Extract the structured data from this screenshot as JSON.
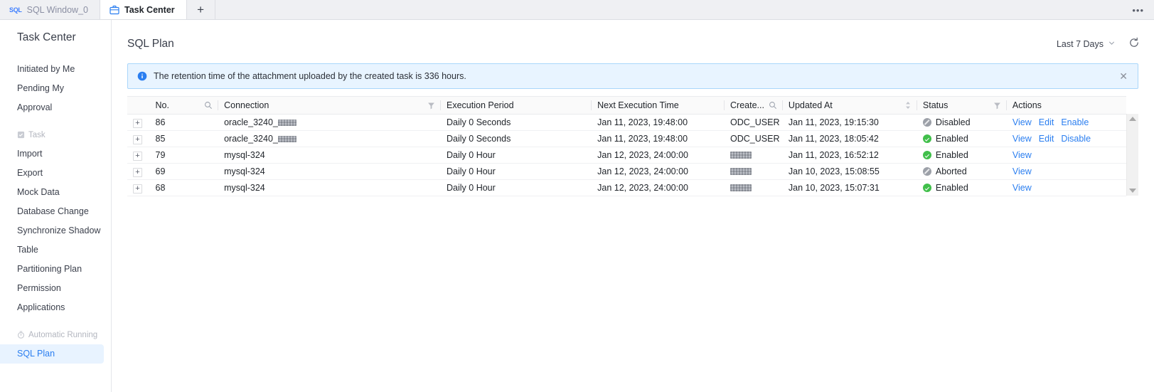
{
  "tabs": [
    {
      "label": "SQL Window_0",
      "icon": "sql-icon",
      "active": false
    },
    {
      "label": "Task Center",
      "icon": "task-center-icon",
      "active": true
    }
  ],
  "tabbar": {
    "add_label": "+",
    "more_label": "•••"
  },
  "sidebar": {
    "title": "Task Center",
    "items": [
      {
        "label": "Initiated by Me",
        "name": "initiated-by-me"
      },
      {
        "label": "Pending My",
        "name": "pending-my"
      },
      {
        "label": "Approval",
        "name": "approval"
      }
    ],
    "groups": [
      {
        "label": "Task",
        "icon": "task-group-icon",
        "items": [
          {
            "label": "Import",
            "name": "import"
          },
          {
            "label": "Export",
            "name": "export"
          },
          {
            "label": "Mock Data",
            "name": "mock-data"
          },
          {
            "label": "Database Change",
            "name": "database-change"
          },
          {
            "label": "Synchronize Shadow",
            "name": "synchronize-shadow"
          },
          {
            "label": "Table",
            "name": "table"
          },
          {
            "label": "Partitioning Plan",
            "name": "partitioning-plan"
          },
          {
            "label": "Permission",
            "name": "permission"
          },
          {
            "label": "Applications",
            "name": "applications"
          }
        ]
      },
      {
        "label": "Automatic Running",
        "icon": "automatic-running-icon",
        "items": [
          {
            "label": "SQL Plan",
            "name": "sql-plan",
            "active": true
          }
        ]
      }
    ]
  },
  "header": {
    "title": "SQL Plan",
    "range_label": "Last 7 Days",
    "refresh_icon": "refresh-icon"
  },
  "banner": {
    "icon": "info-icon",
    "text": "The retention time of the attachment uploaded by the created task is 336 hours.",
    "close_label": "✕"
  },
  "table": {
    "columns": [
      {
        "key": "expander",
        "label": "",
        "icon": ""
      },
      {
        "key": "no",
        "label": "No.",
        "icon": "search-icon"
      },
      {
        "key": "connection",
        "label": "Connection",
        "icon": "filter-icon"
      },
      {
        "key": "execution_period",
        "label": "Execution Period",
        "icon": ""
      },
      {
        "key": "next_execution_time",
        "label": "Next Execution Time",
        "icon": ""
      },
      {
        "key": "creator",
        "label": "Create...",
        "icon": "search-icon"
      },
      {
        "key": "updated_at",
        "label": "Updated At",
        "icon": "sort-icon"
      },
      {
        "key": "status",
        "label": "Status",
        "icon": "filter-icon"
      },
      {
        "key": "actions",
        "label": "Actions",
        "icon": ""
      }
    ],
    "rows": [
      {
        "expander": "+",
        "no": "86",
        "connection": "oracle_3240_",
        "connection_redacted": true,
        "execution_period": "Daily 0 Seconds",
        "next_execution_time": "Jan 11, 2023, 19:48:00",
        "creator": "ODC_USER",
        "creator_redacted": false,
        "updated_at": "Jan 11, 2023, 19:15:30",
        "status": "Disabled",
        "status_type": "disabled",
        "actions": [
          "View",
          "Edit",
          "Enable"
        ]
      },
      {
        "expander": "+",
        "no": "85",
        "connection": "oracle_3240_",
        "connection_redacted": true,
        "execution_period": "Daily 0 Seconds",
        "next_execution_time": "Jan 11, 2023, 19:48:00",
        "creator": "ODC_USER",
        "creator_redacted": false,
        "updated_at": "Jan 11, 2023, 18:05:42",
        "status": "Enabled",
        "status_type": "enabled",
        "actions": [
          "View",
          "Edit",
          "Disable"
        ]
      },
      {
        "expander": "+",
        "no": "79",
        "connection": "mysql-324",
        "connection_redacted": false,
        "execution_period": "Daily 0 Hour",
        "next_execution_time": "Jan 12, 2023, 24:00:00",
        "creator": "",
        "creator_redacted": true,
        "updated_at": "Jan 11, 2023, 16:52:12",
        "status": "Enabled",
        "status_type": "enabled",
        "actions": [
          "View"
        ]
      },
      {
        "expander": "+",
        "no": "69",
        "connection": "mysql-324",
        "connection_redacted": false,
        "execution_period": "Daily 0 Hour",
        "next_execution_time": "Jan 12, 2023, 24:00:00",
        "creator": "",
        "creator_redacted": true,
        "updated_at": "Jan 10, 2023, 15:08:55",
        "status": "Aborted",
        "status_type": "disabled",
        "actions": [
          "View"
        ]
      },
      {
        "expander": "+",
        "no": "68",
        "connection": "mysql-324",
        "connection_redacted": false,
        "execution_period": "Daily 0 Hour",
        "next_execution_time": "Jan 12, 2023, 24:00:00",
        "creator": "",
        "creator_redacted": true,
        "updated_at": "Jan 10, 2023, 15:07:31",
        "status": "Enabled",
        "status_type": "enabled",
        "actions": [
          "View"
        ]
      }
    ]
  },
  "colors": {
    "accent": "#2a7ef0",
    "enabled": "#41bf4b",
    "disabled": "#9ca0a8",
    "banner_bg": "#e8f4ff",
    "banner_border": "#a9d6fb",
    "active_sidebar_bg": "#e8f3ff"
  }
}
